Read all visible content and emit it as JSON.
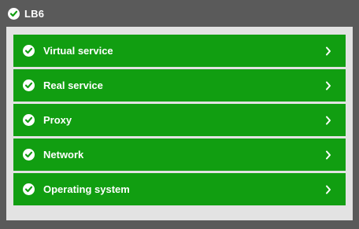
{
  "header": {
    "title": "LB6",
    "icon": "check-circle-icon"
  },
  "colors": {
    "background": "#5a5a5a",
    "panel": "#e3e3e3",
    "item": "#119e11",
    "text": "#ffffff"
  },
  "items": [
    {
      "label": "Virtual service",
      "icon": "check-circle-icon",
      "status": "ok"
    },
    {
      "label": "Real service",
      "icon": "check-circle-icon",
      "status": "ok"
    },
    {
      "label": "Proxy",
      "icon": "check-circle-icon",
      "status": "ok"
    },
    {
      "label": "Network",
      "icon": "check-circle-icon",
      "status": "ok"
    },
    {
      "label": "Operating system",
      "icon": "check-circle-icon",
      "status": "ok"
    }
  ]
}
